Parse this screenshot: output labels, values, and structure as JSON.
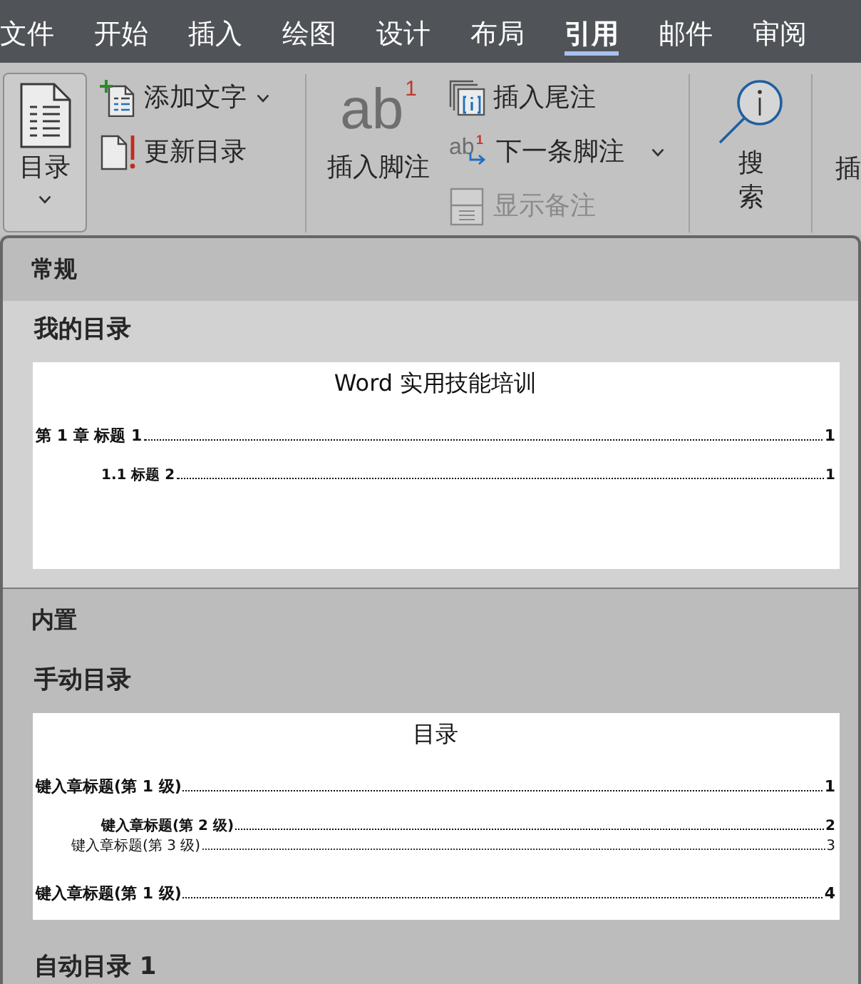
{
  "ribbon_tabs": [
    {
      "label": "文件",
      "selected": false
    },
    {
      "label": "开始",
      "selected": false
    },
    {
      "label": "插入",
      "selected": false
    },
    {
      "label": "绘图",
      "selected": false
    },
    {
      "label": "设计",
      "selected": false
    },
    {
      "label": "布局",
      "selected": false
    },
    {
      "label": "引用",
      "selected": true
    },
    {
      "label": "邮件",
      "selected": false
    },
    {
      "label": "审阅",
      "selected": false
    }
  ],
  "ribbon": {
    "table_of_contents": {
      "label": "目录",
      "expanded": true,
      "dropdown": true
    },
    "add_text": {
      "label": "添加文字",
      "dropdown": true
    },
    "update_table": {
      "label": "更新目录"
    },
    "insert_footnote": {
      "label": "插入脚注",
      "icon_text": "ab",
      "icon_superscript": "1"
    },
    "insert_endnote": {
      "label": "插入尾注"
    },
    "next_footnote": {
      "label": "下一条脚注",
      "icon_text": "ab",
      "icon_superscript": "1",
      "dropdown": true
    },
    "show_notes": {
      "label": "显示备注",
      "disabled": true
    },
    "search": {
      "label": "搜索"
    },
    "cut_off_button": {
      "label": "插"
    }
  },
  "gallery": {
    "sections": [
      {
        "title": "常规",
        "items": [
          {
            "title": "我的目录",
            "selected": true,
            "preview": {
              "title": "Word 实用技能培训",
              "entries": [
                {
                  "text": "第 1 章 标题 1",
                  "page": "1",
                  "children": [
                    {
                      "text": "1.1 标题 2",
                      "page": "1"
                    }
                  ]
                }
              ]
            }
          }
        ]
      },
      {
        "title": "内置",
        "items": [
          {
            "title": "手动目录",
            "selected": false,
            "preview": {
              "title": "目录",
              "entries": [
                {
                  "text": "键入章标题(第 1 级)",
                  "page": "1",
                  "children": [
                    {
                      "text": "键入章标题(第 2 级)",
                      "page": "2",
                      "children": [
                        {
                          "text": "键入章标题(第 3 级)",
                          "page": "3"
                        }
                      ]
                    }
                  ]
                },
                {
                  "text": "键入章标题(第 1 级)",
                  "page": "4"
                }
              ]
            }
          },
          {
            "title": "自动目录 1",
            "selected": false
          }
        ]
      }
    ]
  }
}
